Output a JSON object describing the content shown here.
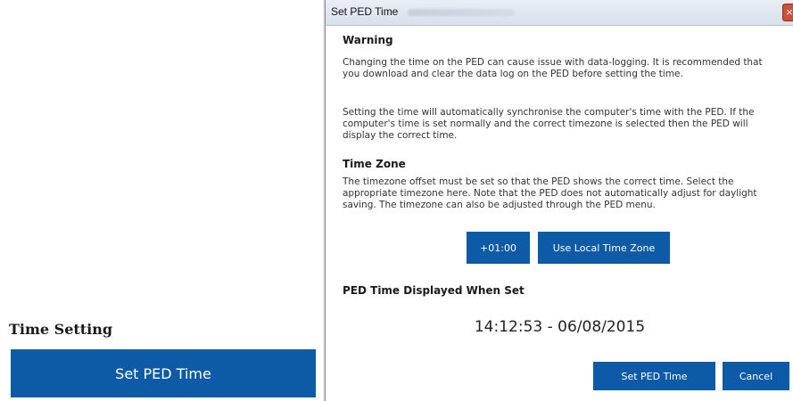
{
  "background": {
    "heading": "Time Setting",
    "set_button_label": "Set PED Time"
  },
  "dialog": {
    "title": "Set PED Time",
    "close_label": "×",
    "warning": {
      "heading": "Warning",
      "paragraph1": "Changing the time on the PED can cause issue with data-logging. It is recommended that you download and clear the data log on the PED before setting the time.",
      "paragraph2": "Setting the time will automatically synchronise the computer's time with the PED. If the computer's time is set normally and the correct timezone is selected then the PED will display the correct time."
    },
    "timezone": {
      "heading": "Time Zone",
      "paragraph": "The timezone offset must be set so that the PED shows the correct time. Select the appropriate timezone here. Note that the PED does not automatically adjust for daylight saving. The timezone can also be adjusted through the PED menu.",
      "offset_label": "+01:00",
      "local_button_label": "Use Local Time Zone"
    },
    "ped_time": {
      "heading": "PED Time Displayed When Set",
      "value": "14:12:53 - 06/08/2015"
    },
    "footer": {
      "set_button_label": "Set PED Time",
      "cancel_button_label": "Cancel"
    }
  },
  "colors": {
    "accent": "#0d5aa7",
    "titlebar": "#dde5f0",
    "close": "#c9503b"
  },
  "icons": {
    "close": "close-icon"
  }
}
